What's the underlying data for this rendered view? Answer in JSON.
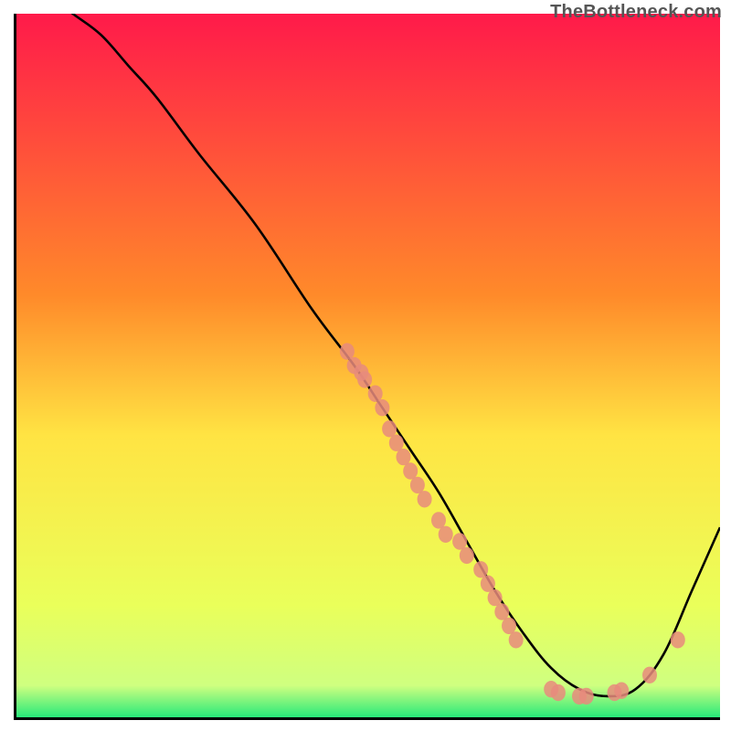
{
  "watermark": "TheBottleneck.com",
  "chart_data": {
    "type": "line",
    "title": "",
    "xlabel": "",
    "ylabel": "",
    "xlim": [
      0,
      100
    ],
    "ylim": [
      0,
      100
    ],
    "grid": false,
    "legend": false,
    "background": {
      "type": "vertical-gradient",
      "stops": [
        {
          "offset": 0,
          "color": "#ff1a4a"
        },
        {
          "offset": 40,
          "color": "#ff8a2a"
        },
        {
          "offset": 60,
          "color": "#ffe443"
        },
        {
          "offset": 84,
          "color": "#eaff5a"
        },
        {
          "offset": 95.5,
          "color": "#cfff80"
        },
        {
          "offset": 100,
          "color": "#27e97a"
        }
      ]
    },
    "series": [
      {
        "name": "bottleneck-curve",
        "color": "#000000",
        "x": [
          0,
          4,
          8,
          12,
          16,
          20,
          26,
          34,
          42,
          48,
          52,
          56,
          60,
          64,
          68,
          72,
          76,
          80,
          84,
          88,
          92,
          96,
          100
        ],
        "y": [
          109,
          103,
          100,
          97,
          92.5,
          88,
          80,
          70,
          58,
          50,
          44,
          38,
          32,
          25,
          18,
          12,
          7,
          4,
          3,
          4,
          9,
          18,
          27
        ]
      }
    ],
    "scatter": [
      {
        "name": "curve-dots",
        "color": "#e88b7d",
        "radius": 8,
        "points": [
          {
            "x": 47,
            "y": 52
          },
          {
            "x": 48,
            "y": 50
          },
          {
            "x": 49,
            "y": 49
          },
          {
            "x": 49.5,
            "y": 48
          },
          {
            "x": 51,
            "y": 46
          },
          {
            "x": 52,
            "y": 44
          },
          {
            "x": 53,
            "y": 41
          },
          {
            "x": 54,
            "y": 39
          },
          {
            "x": 55,
            "y": 37
          },
          {
            "x": 56,
            "y": 35
          },
          {
            "x": 57,
            "y": 33
          },
          {
            "x": 58,
            "y": 31
          },
          {
            "x": 60,
            "y": 28
          },
          {
            "x": 61,
            "y": 26
          },
          {
            "x": 63,
            "y": 25
          },
          {
            "x": 64,
            "y": 23
          },
          {
            "x": 66,
            "y": 21
          },
          {
            "x": 67,
            "y": 19
          },
          {
            "x": 68,
            "y": 17
          },
          {
            "x": 69,
            "y": 15
          },
          {
            "x": 70,
            "y": 13
          },
          {
            "x": 71,
            "y": 11
          },
          {
            "x": 76,
            "y": 4
          },
          {
            "x": 77,
            "y": 3.5
          },
          {
            "x": 80,
            "y": 3
          },
          {
            "x": 81,
            "y": 3
          },
          {
            "x": 85,
            "y": 3.5
          },
          {
            "x": 86,
            "y": 3.8
          },
          {
            "x": 90,
            "y": 6
          },
          {
            "x": 94,
            "y": 11
          }
        ]
      }
    ]
  }
}
